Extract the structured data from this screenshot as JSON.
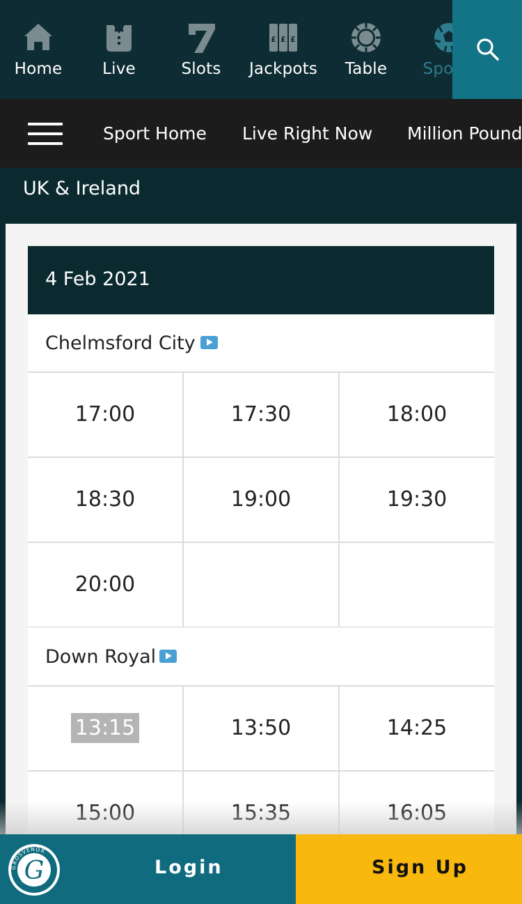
{
  "topnav": {
    "items": [
      {
        "label": "Home",
        "icon": "home-icon"
      },
      {
        "label": "Live",
        "icon": "tuxedo-icon"
      },
      {
        "label": "Slots",
        "icon": "seven-icon"
      },
      {
        "label": "Jackpots",
        "icon": "jackpot-reels-icon"
      },
      {
        "label": "Table",
        "icon": "chip-icon"
      },
      {
        "label": "Sports",
        "icon": "football-icon"
      }
    ],
    "search_icon": "search-icon"
  },
  "subnav": {
    "links": [
      "Sport Home",
      "Live Right Now",
      "Million Pound"
    ]
  },
  "section": {
    "title": "UK & Ireland"
  },
  "date": "4 Feb 2021",
  "meetings": [
    {
      "name": "Chelmsford City",
      "times": [
        "17:00",
        "17:30",
        "18:00",
        "18:30",
        "19:00",
        "19:30",
        "20:00",
        "",
        ""
      ]
    },
    {
      "name": "Down Royal",
      "times": [
        "13:15",
        "13:50",
        "14:25",
        "15:00",
        "15:35",
        "16:05"
      ],
      "selected": "13:15"
    }
  ],
  "footer": {
    "login": "Login",
    "signup": "Sign Up",
    "logo_text": "GROSVENOR CASINOS"
  },
  "colors": {
    "dark_teal": "#0b2a30",
    "accent_teal": "#137487",
    "signup_yellow": "#f8b80d"
  }
}
